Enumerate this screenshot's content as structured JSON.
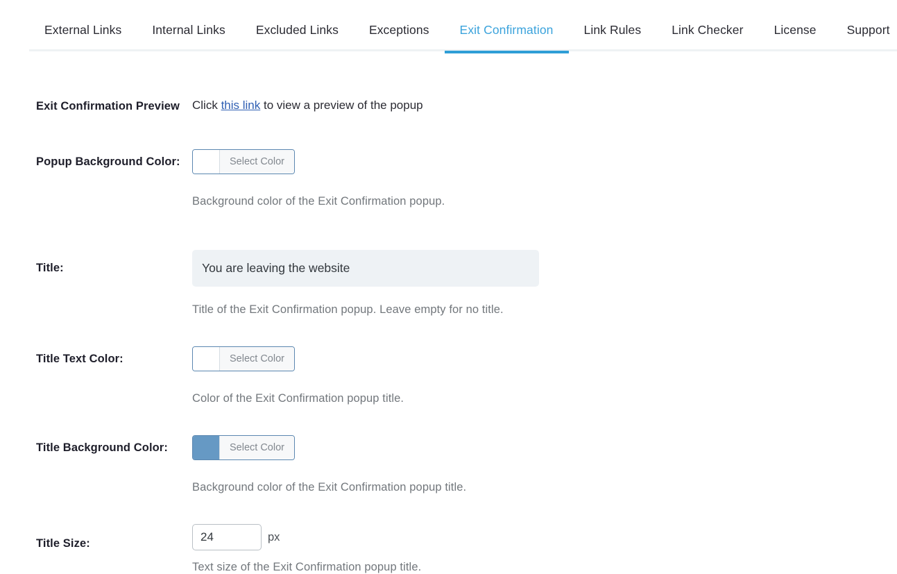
{
  "theme": {
    "accent": "#3ba3dc",
    "accent_underline": "#2f9ed6",
    "link": "#2f5fb3",
    "label": "#1e1e2a",
    "description": "#72777c",
    "input_bg": "#eef2f5",
    "picker_border": "#5b87b0"
  },
  "tabs": [
    {
      "label": "External Links",
      "active": false
    },
    {
      "label": "Internal Links",
      "active": false
    },
    {
      "label": "Excluded Links",
      "active": false
    },
    {
      "label": "Exceptions",
      "active": false
    },
    {
      "label": "Exit Confirmation",
      "active": true
    },
    {
      "label": "Link Rules",
      "active": false
    },
    {
      "label": "Link Checker",
      "active": false
    },
    {
      "label": "License",
      "active": false
    },
    {
      "label": "Support",
      "active": false
    }
  ],
  "rows": {
    "preview": {
      "label": "Exit Confirmation Preview",
      "text_before": "Click ",
      "link_text": "this link",
      "text_after": " to view a preview of the popup"
    },
    "popup_background_color": {
      "label": "Popup Background Color:",
      "button_label": "Select Color",
      "swatch_color": "#ffffff",
      "description": "Background color of the Exit Confirmation popup."
    },
    "title": {
      "label": "Title:",
      "value": "You are leaving the website",
      "placeholder": "",
      "description": "Title of the Exit Confirmation popup. Leave empty for no title."
    },
    "title_text_color": {
      "label": "Title Text Color:",
      "button_label": "Select Color",
      "swatch_color": "#ffffff",
      "description": "Color of the Exit Confirmation popup title."
    },
    "title_background_color": {
      "label": "Title Background Color:",
      "button_label": "Select Color",
      "swatch_color": "#6699c4",
      "description": "Background color of the Exit Confirmation popup title."
    },
    "title_size": {
      "label": "Title Size:",
      "value": "24",
      "unit": "px",
      "description": "Text size of the Exit Confirmation popup title."
    }
  }
}
